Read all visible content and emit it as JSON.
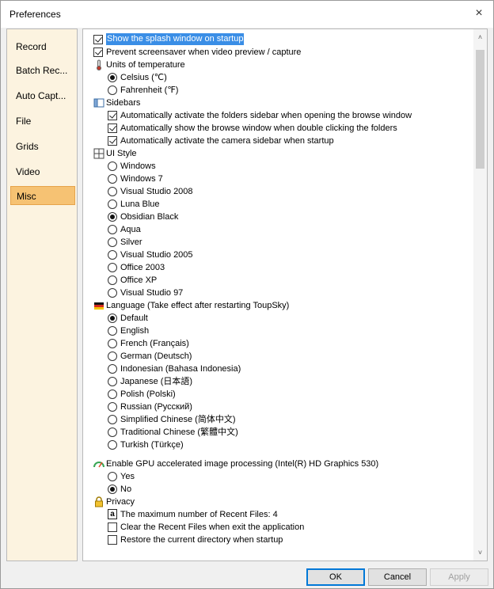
{
  "window": {
    "title": "Preferences",
    "close_glyph": "×"
  },
  "nav": {
    "items": [
      {
        "label": "Record",
        "selected": false
      },
      {
        "label": "Batch Rec...",
        "selected": false
      },
      {
        "label": "Auto Capt...",
        "selected": false
      },
      {
        "label": "File",
        "selected": false
      },
      {
        "label": "Grids",
        "selected": false
      },
      {
        "label": "Video",
        "selected": false
      },
      {
        "label": "Misc",
        "selected": true
      }
    ]
  },
  "options": {
    "splash": "Show the splash window on startup",
    "screensaver": "Prevent screensaver when video preview / capture",
    "temperature": {
      "heading": "Units of temperature",
      "celsius": "Celsius (℃)",
      "fahrenheit": "Fahrenheit (℉)"
    },
    "sidebars": {
      "heading": "Sidebars",
      "folders": "Automatically activate the folders sidebar when opening the browse window",
      "browse": "Automatically show the browse window when double clicking the folders",
      "camera": "Automatically activate the camera sidebar when startup"
    },
    "ui_style": {
      "heading": "UI Style",
      "items": [
        "Windows",
        "Windows 7",
        "Visual Studio 2008",
        "Luna Blue",
        "Obsidian Black",
        "Aqua",
        "Silver",
        "Visual Studio 2005",
        "Office 2003",
        "Office XP",
        "Visual Studio 97"
      ],
      "selected": "Obsidian Black"
    },
    "language": {
      "heading": "Language (Take effect after restarting ToupSky)",
      "items": [
        "Default",
        "English",
        "French (Français)",
        "German (Deutsch)",
        "Indonesian (Bahasa Indonesia)",
        "Japanese (日本語)",
        "Polish (Polski)",
        "Russian (Русский)",
        "Simplified Chinese (简体中文)",
        "Traditional Chinese (繁體中文)",
        "Turkish (Türkçe)"
      ],
      "selected": "Default"
    },
    "gpu": {
      "heading": "Enable GPU accelerated image processing (Intel(R) HD Graphics 530)",
      "yes": "Yes",
      "no": "No"
    },
    "privacy": {
      "heading": "Privacy",
      "max_recent_badge": "a",
      "max_recent": "The maximum number of Recent Files: 4",
      "clear_recent": "Clear the Recent Files when exit the application",
      "restore_dir": "Restore the current directory when startup"
    }
  },
  "scroll": {
    "up_glyph": "˄",
    "down_glyph": "˅"
  },
  "buttons": {
    "ok": "OK",
    "cancel": "Cancel",
    "apply": "Apply"
  },
  "colors": {
    "nav_bg": "#fcf3e0",
    "nav_selected": "#f6c273",
    "highlight": "#3a8ee6",
    "default_button": "#0078d7"
  }
}
